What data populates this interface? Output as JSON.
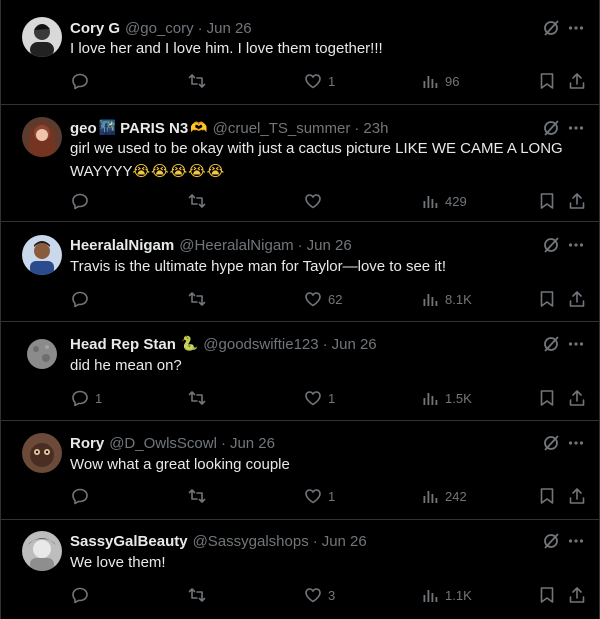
{
  "colors": {
    "background": "#000000",
    "text": "#e7e9ea",
    "muted": "#71767b",
    "divider": "#2f3336"
  },
  "tweets": [
    {
      "name": "Cory G",
      "handle": "@go_cory",
      "time": "Jun 26",
      "text": "I love her and I love him. I love them together!!!",
      "replies": "",
      "retweets": "",
      "likes": "1",
      "views": "96",
      "avatar": "avatar-photo"
    },
    {
      "name": "geo",
      "name_emoji": "🌃",
      "name_suffix": "PARIS N3",
      "name_suffix_emoji": "🫶",
      "handle": "@cruel_TS_summer",
      "time": "23h",
      "text": "girl we used to be okay with just a cactus picture LIKE WE CAME A LONG WAYYYY",
      "text_emoji": "😭😭😭😭😭",
      "replies": "",
      "retweets": "",
      "likes": "",
      "views": "429",
      "avatar": "avatar-photo"
    },
    {
      "name": "HeeralalNigam",
      "handle": "@HeeralalNigam",
      "time": "Jun 26",
      "text": "Travis is the ultimate hype man for Taylor—love to see it!",
      "replies": "",
      "retweets": "",
      "likes": "62",
      "views": "8.1K",
      "avatar": "avatar-photo"
    },
    {
      "name": "Head Rep Stan",
      "name_emoji": "🐍",
      "handle": "@goodswiftie123",
      "time": "Jun 26",
      "text": "did he mean on?",
      "replies": "1",
      "retweets": "",
      "likes": "1",
      "views": "1.5K",
      "avatar": "avatar-moon"
    },
    {
      "name": "Rory",
      "handle": "@D_OwlsScowl",
      "time": "Jun 26",
      "text": "Wow what a great looking couple",
      "replies": "",
      "retweets": "",
      "likes": "1",
      "views": "242",
      "avatar": "avatar-photo"
    },
    {
      "name": "SassyGalBeauty",
      "handle": "@Sassygalshops",
      "time": "Jun 26",
      "text": "We love them!",
      "replies": "",
      "retweets": "",
      "likes": "3",
      "views": "1.1K",
      "avatar": "avatar-photo"
    }
  ]
}
